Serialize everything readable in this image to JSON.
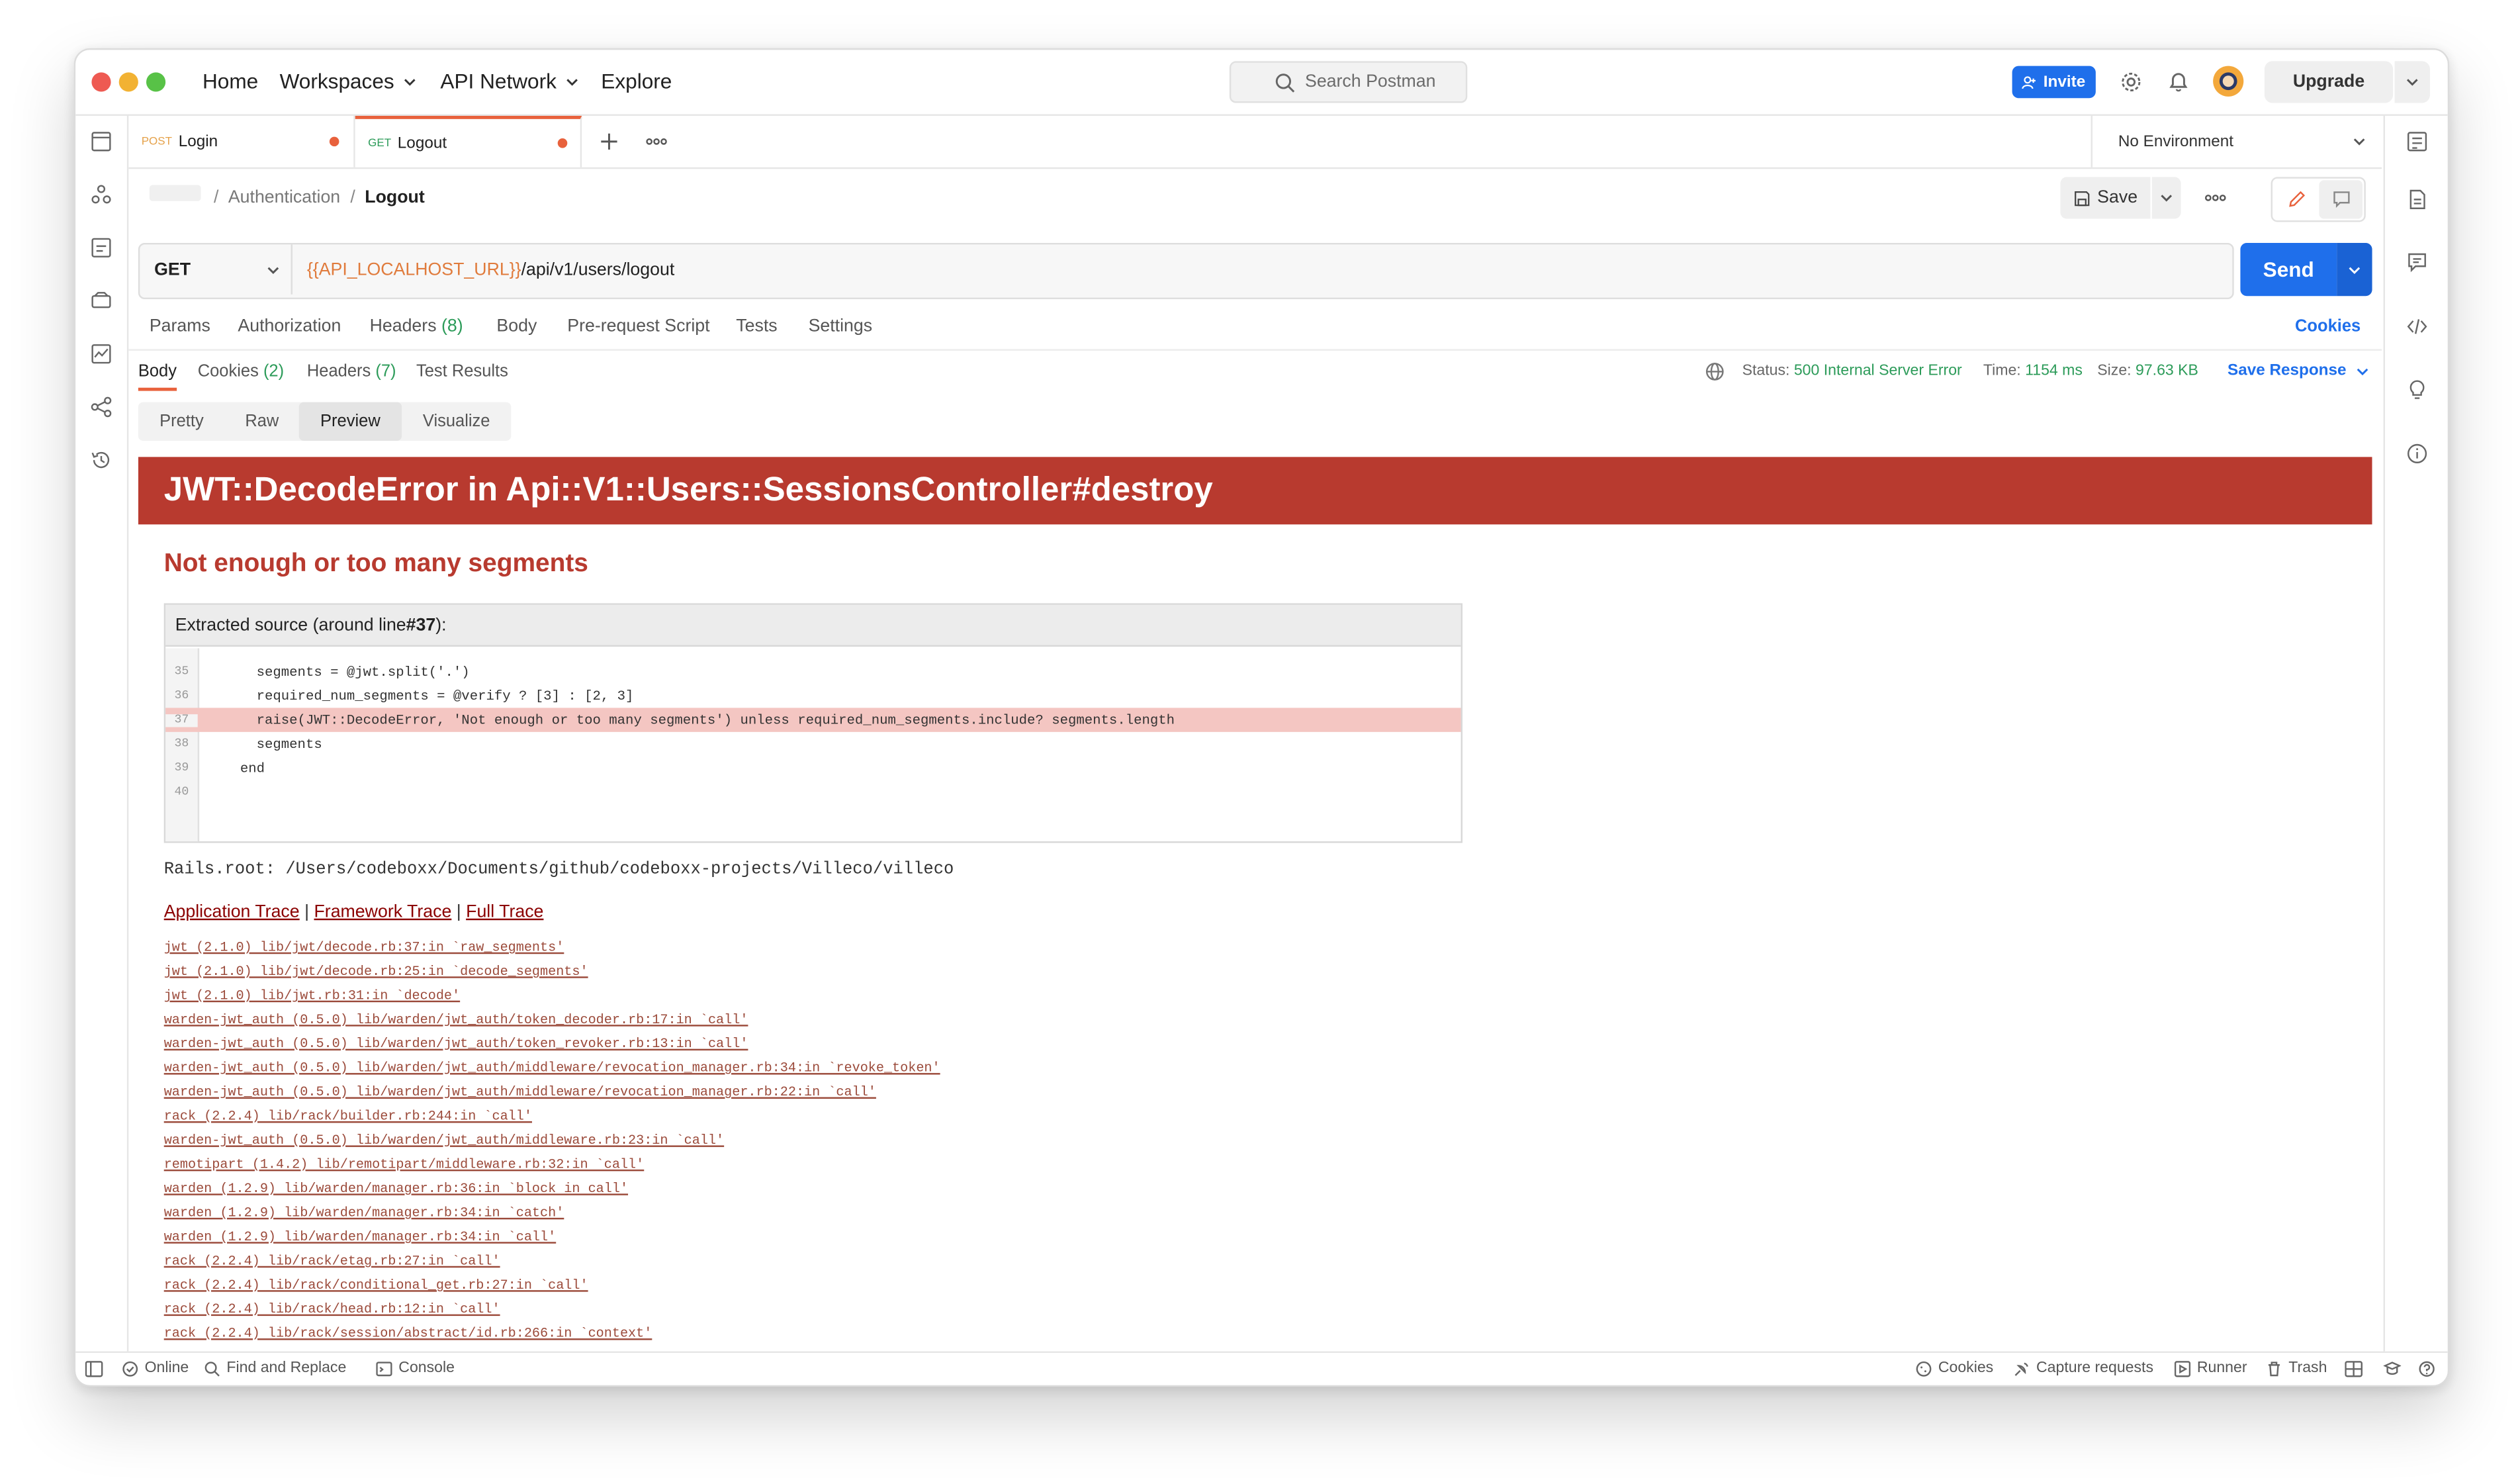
{
  "titlebar": {
    "nav": [
      "Home",
      "Workspaces",
      "API Network",
      "Explore"
    ],
    "search_placeholder": "Search Postman",
    "invite_label": "Invite",
    "upgrade_label": "Upgrade"
  },
  "tabs": [
    {
      "method": "POST",
      "label": "Login"
    },
    {
      "method": "GET",
      "label": "Logout"
    }
  ],
  "environment": "No Environment",
  "breadcrumb": {
    "parent": "Authentication",
    "current": "Logout"
  },
  "toolbar": {
    "save_label": "Save"
  },
  "request": {
    "method": "GET",
    "url_variable": "{{API_LOCALHOST_URL}}",
    "url_path": "/api/v1/users/logout",
    "send_label": "Send"
  },
  "request_tabs": {
    "params": "Params",
    "authorization": "Authorization",
    "headers": "Headers",
    "headers_count": "(8)",
    "body": "Body",
    "prerequest": "Pre-request Script",
    "tests": "Tests",
    "settings": "Settings",
    "cookies": "Cookies"
  },
  "response_tabs": {
    "body": "Body",
    "cookies": "Cookies",
    "cookies_count": "(2)",
    "headers": "Headers",
    "headers_count": "(7)",
    "test_results": "Test Results"
  },
  "response_status": {
    "status_label": "Status:",
    "status_value": "500 Internal Server Error",
    "time_label": "Time:",
    "time_value": "1154 ms",
    "size_label": "Size:",
    "size_value": "97.63 KB",
    "save_response": "Save Response"
  },
  "view_tabs": [
    "Pretty",
    "Raw",
    "Preview",
    "Visualize"
  ],
  "preview": {
    "title": "JWT::DecodeError in Api::V1::Users::SessionsController#destroy",
    "subtitle": "Not enough or too many segments",
    "source_header_prefix": "Extracted source (around line ",
    "source_header_line": "#37",
    "source_header_suffix": "):",
    "code_lines": [
      {
        "n": "35",
        "text": "      segments = @jwt.split('.')"
      },
      {
        "n": "36",
        "text": "      required_num_segments = @verify ? [3] : [2, 3]"
      },
      {
        "n": "37",
        "text": "      raise(JWT::DecodeError, 'Not enough or too many segments') unless required_num_segments.include? segments.length"
      },
      {
        "n": "38",
        "text": "      segments"
      },
      {
        "n": "39",
        "text": "    end"
      },
      {
        "n": "40",
        "text": ""
      }
    ],
    "rails_root": "Rails.root: /Users/codeboxx/Documents/github/codeboxx-projects/Villeco/villeco",
    "trace_links": [
      "Application Trace",
      "Framework Trace",
      "Full Trace"
    ],
    "trace_separator": "|",
    "trace": [
      "jwt (2.1.0) lib/jwt/decode.rb:37:in `raw_segments'",
      "jwt (2.1.0) lib/jwt/decode.rb:25:in `decode_segments'",
      "jwt (2.1.0) lib/jwt.rb:31:in `decode'",
      "warden-jwt_auth (0.5.0) lib/warden/jwt_auth/token_decoder.rb:17:in `call'",
      "warden-jwt_auth (0.5.0) lib/warden/jwt_auth/token_revoker.rb:13:in `call'",
      "warden-jwt_auth (0.5.0) lib/warden/jwt_auth/middleware/revocation_manager.rb:34:in `revoke_token'",
      "warden-jwt_auth (0.5.0) lib/warden/jwt_auth/middleware/revocation_manager.rb:22:in `call'",
      "rack (2.2.4) lib/rack/builder.rb:244:in `call'",
      "warden-jwt_auth (0.5.0) lib/warden/jwt_auth/middleware.rb:23:in `call'",
      "remotipart (1.4.2) lib/remotipart/middleware.rb:32:in `call'",
      "warden (1.2.9) lib/warden/manager.rb:36:in `block in call'",
      "warden (1.2.9) lib/warden/manager.rb:34:in `catch'",
      "warden (1.2.9) lib/warden/manager.rb:34:in `call'",
      "rack (2.2.4) lib/rack/etag.rb:27:in `call'",
      "rack (2.2.4) lib/rack/conditional_get.rb:27:in `call'",
      "rack (2.2.4) lib/rack/head.rb:12:in `call'",
      "rack (2.2.4) lib/rack/session/abstract/id.rb:266:in `context'"
    ]
  },
  "bottombar": {
    "online": "Online",
    "find_replace": "Find and Replace",
    "console": "Console",
    "cookies": "Cookies",
    "capture": "Capture requests",
    "runner": "Runner",
    "trash": "Trash"
  },
  "colors": {
    "accent": "#1f6feb",
    "error_banner": "#b83a2f",
    "status_ok_text": "#2c9b59",
    "unsaved_dot": "#e8613c"
  }
}
